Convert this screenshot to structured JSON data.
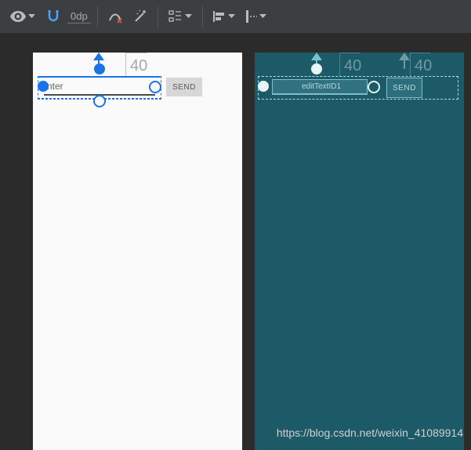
{
  "toolbar": {
    "margin_value": "0dp"
  },
  "design": {
    "edit_placeholder": "nter",
    "btn_label": "SEND",
    "guide_value": "40"
  },
  "blueprint": {
    "edit_id": "editTextID1",
    "btn_label": "SEND",
    "guide_value": "40",
    "guide_value2": "40"
  },
  "watermark": "https://blog.csdn.net/weixin_41089914"
}
